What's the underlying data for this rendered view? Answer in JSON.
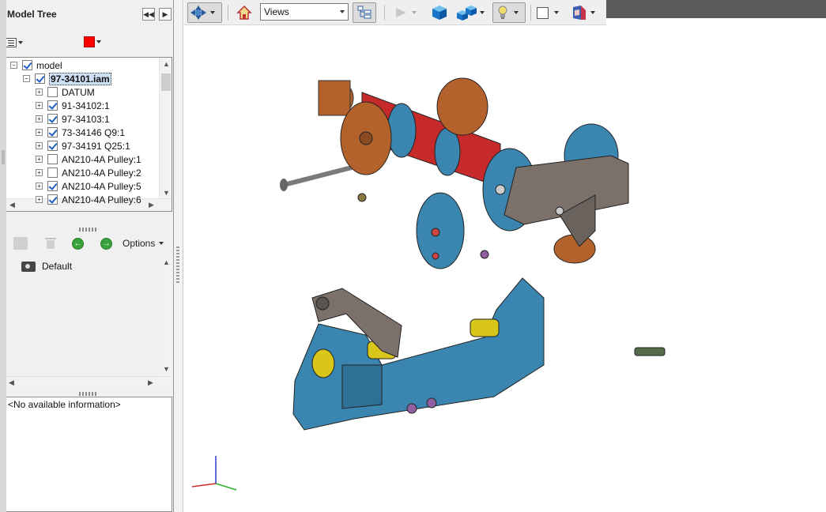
{
  "model_tree": {
    "title": "Model Tree",
    "collapse_tooltip": "Collapse",
    "expand_tooltip": "Expand",
    "color_swatch": "#ff0000",
    "nodes": [
      {
        "label": "model",
        "checked": true,
        "level": 0,
        "expander": "−"
      },
      {
        "label": "97-34101.iam",
        "checked": true,
        "level": 1,
        "expander": "−",
        "selected": true
      },
      {
        "label": "DATUM",
        "checked": false,
        "level": 2,
        "expander": "+"
      },
      {
        "label": "91-34102:1",
        "checked": true,
        "level": 2,
        "expander": "+"
      },
      {
        "label": "97-34103:1",
        "checked": true,
        "level": 2,
        "expander": "+"
      },
      {
        "label": "73-34146 Q9:1",
        "checked": true,
        "level": 2,
        "expander": "+"
      },
      {
        "label": "97-34191 Q25:1",
        "checked": true,
        "level": 2,
        "expander": "+"
      },
      {
        "label": "AN210-4A Pulley:1",
        "checked": false,
        "level": 2,
        "expander": "+"
      },
      {
        "label": "AN210-4A Pulley:2",
        "checked": false,
        "level": 2,
        "expander": "+"
      },
      {
        "label": "AN210-4A Pulley:5",
        "checked": true,
        "level": 2,
        "expander": "+"
      },
      {
        "label": "AN210-4A Pulley:6",
        "checked": true,
        "level": 2,
        "expander": "+"
      }
    ]
  },
  "views_panel": {
    "options_label": "Options",
    "items": [
      {
        "label": "Default"
      }
    ]
  },
  "info_panel": {
    "text": "<No available information>"
  },
  "toolbar": {
    "views_select_value": "Views",
    "icons": [
      "rotate-icon",
      "home-icon",
      "model-tree-icon",
      "play-icon",
      "solid-box-icon",
      "render-mode-icon",
      "lighting-icon",
      "background-color-icon",
      "cross-section-icon"
    ]
  },
  "colors": {
    "part_blue": "#3a86b0",
    "part_copper": "#b4622c",
    "part_red": "#c62a2a",
    "part_grey": "#7b706a",
    "part_yellow": "#d9c61a"
  }
}
